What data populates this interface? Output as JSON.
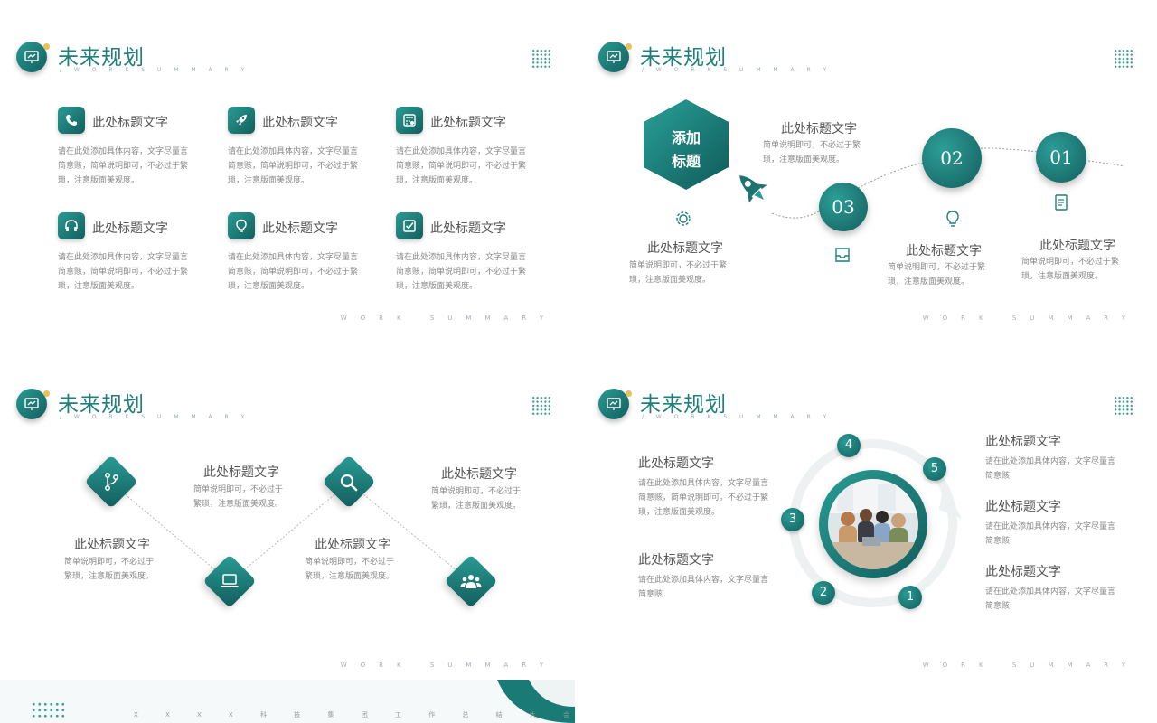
{
  "header": {
    "title": "未来规划",
    "subtitle": "/ W O R K   S U M M A R Y"
  },
  "footer_tag": "WORK SUMMARY",
  "slide1": {
    "items": [
      {
        "title": "此处标题文字",
        "body": "请在此处添加具体内容，文字尽量言简意赅，简单说明即可，不必过于繁琐，注意版面美观度。"
      },
      {
        "title": "此处标题文字",
        "body": "请在此处添加具体内容，文字尽量言简意赅，简单说明即可，不必过于繁琐，注意版面美观度。"
      },
      {
        "title": "此处标题文字",
        "body": "请在此处添加具体内容，文字尽量言简意赅，简单说明即可，不必过于繁琐，注意版面美观度。"
      },
      {
        "title": "此处标题文字",
        "body": "请在此处添加具体内容，文字尽量言简意赅，简单说明即可，不必过于繁琐，注意版面美观度。"
      },
      {
        "title": "此处标题文字",
        "body": "请在此处添加具体内容，文字尽量言简意赅，简单说明即可，不必过于繁琐，注意版面美观度。"
      },
      {
        "title": "此处标题文字",
        "body": "请在此处添加具体内容，文字尽量言简意赅，简单说明即可，不必过于繁琐，注意版面美观度。"
      }
    ],
    "icons": [
      "phone-icon",
      "rocket-icon",
      "calculator-icon",
      "headphones-icon",
      "lightbulb-icon",
      "checkbox-icon"
    ]
  },
  "slide2": {
    "hex_line1": "添加",
    "hex_line2": "标题",
    "circles": [
      "03",
      "02",
      "01"
    ],
    "items": [
      {
        "title": "此处标题文字",
        "body": "简单说明即可，不必过于繁琐，注意版面美观度。"
      },
      {
        "title": "此处标题文字",
        "body": "简单说明即可，不必过于繁琐，注意版面美观度。"
      },
      {
        "title": "此处标题文字",
        "body": "简单说明即可，不必过于繁琐，注意版面美观度。"
      },
      {
        "title": "此处标题文字",
        "body": "简单说明即可，不必过于繁琐，注意版面美观度。"
      }
    ]
  },
  "slide3": {
    "items": [
      {
        "title": "此处标题文字",
        "body": "简单说明即可，不必过于繁琐，注意版面美观度。"
      },
      {
        "title": "此处标题文字",
        "body": "简单说明即可，不必过于繁琐，注意版面美观度。"
      },
      {
        "title": "此处标题文字",
        "body": "简单说明即可，不必过于繁琐，注意版面美观度。"
      },
      {
        "title": "此处标题文字",
        "body": "简单说明即可，不必过于繁琐，注意版面美观度。"
      }
    ]
  },
  "slide4": {
    "numbers": [
      "4",
      "5",
      "3",
      "2",
      "1"
    ],
    "left_items": [
      {
        "title": "此处标题文字",
        "body": "请在此处添加具体内容，文字尽量言简意赅，简单说明即可，不必过于繁琐，注意版面美观度。"
      },
      {
        "title": "此处标题文字",
        "body": "请在此处添加具体内容，文字尽量言简意赅"
      }
    ],
    "right_items": [
      {
        "title": "此处标题文字",
        "body": "请在此处添加具体内容，文字尽量言简意赅"
      },
      {
        "title": "此处标题文字",
        "body": "请在此处添加具体内容，文字尽量言简意赅"
      },
      {
        "title": "此处标题文字",
        "body": "请在此处添加具体内容，文字尽量言简意赅"
      }
    ]
  },
  "bottom_text": "X X X X 科 技 集 团 工 作 总 结 大 会",
  "colors": {
    "primary": "#1f7f7a",
    "dark": "#125f5e",
    "accent": "#e7c25a"
  }
}
